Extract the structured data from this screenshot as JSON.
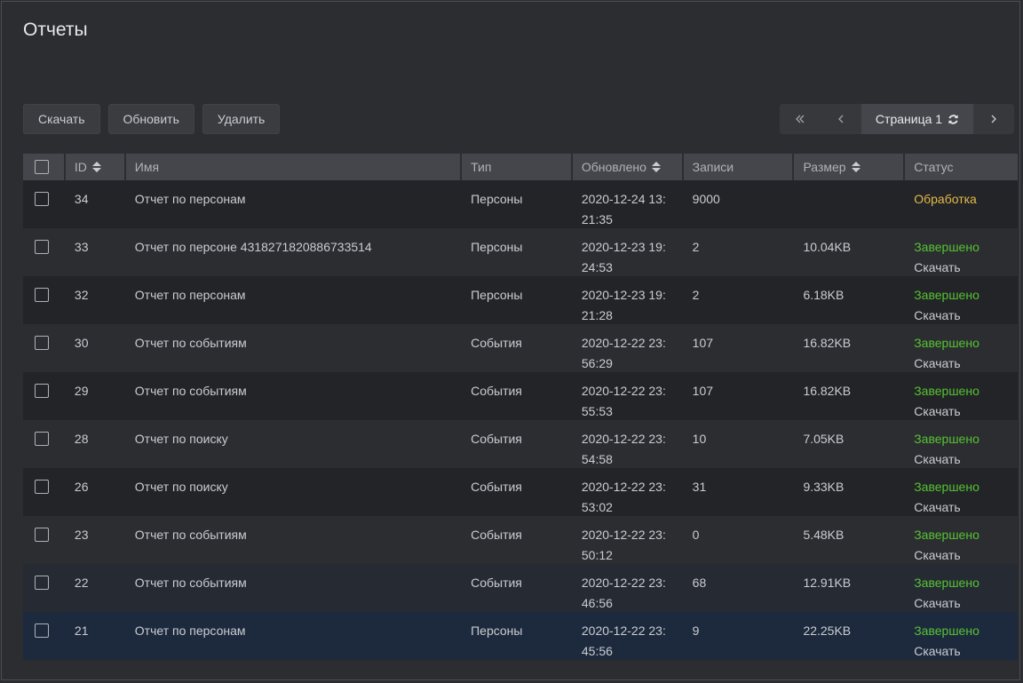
{
  "page": {
    "title": "Отчеты"
  },
  "toolbar": {
    "download": "Скачать",
    "refresh": "Обновить",
    "delete": "Удалить"
  },
  "pager": {
    "current": "Страница 1",
    "first_icon": "double-chevron-left-icon",
    "prev_icon": "chevron-left-icon",
    "next_icon": "chevron-right-icon",
    "refresh_icon": "refresh-icon"
  },
  "columns": {
    "id": "ID",
    "name": "Имя",
    "type": "Тип",
    "updated": "Обновлено",
    "records": "Записи",
    "size": "Размер",
    "status": "Статус"
  },
  "colors": {
    "done": "#56c233",
    "processing": "#e6b84a"
  },
  "rows": [
    {
      "id": "34",
      "name": "Отчет по персонам",
      "type": "Персоны",
      "updated_1": "2020-12-24 13:",
      "updated_2": "21:35",
      "records": "9000",
      "size": "",
      "status": "Обработка",
      "action": ""
    },
    {
      "id": "33",
      "name": "Отчет по персоне 4318271820886733514",
      "type": "Персоны",
      "updated_1": "2020-12-23 19:",
      "updated_2": "24:53",
      "records": "2",
      "size": "10.04KB",
      "status": "Завершено",
      "action": "Скачать"
    },
    {
      "id": "32",
      "name": "Отчет по персонам",
      "type": "Персоны",
      "updated_1": "2020-12-23 19:",
      "updated_2": "21:28",
      "records": "2",
      "size": "6.18KB",
      "status": "Завершено",
      "action": "Скачать"
    },
    {
      "id": "30",
      "name": "Отчет по событиям",
      "type": "События",
      "updated_1": "2020-12-22 23:",
      "updated_2": "56:29",
      "records": "107",
      "size": "16.82KB",
      "status": "Завершено",
      "action": "Скачать"
    },
    {
      "id": "29",
      "name": "Отчет по событиям",
      "type": "События",
      "updated_1": "2020-12-22 23:",
      "updated_2": "55:53",
      "records": "107",
      "size": "16.82KB",
      "status": "Завершено",
      "action": "Скачать"
    },
    {
      "id": "28",
      "name": "Отчет по поиску",
      "type": "События",
      "updated_1": "2020-12-22 23:",
      "updated_2": "54:58",
      "records": "10",
      "size": "7.05KB",
      "status": "Завершено",
      "action": "Скачать"
    },
    {
      "id": "26",
      "name": "Отчет по поиску",
      "type": "События",
      "updated_1": "2020-12-22 23:",
      "updated_2": "53:02",
      "records": "31",
      "size": "9.33KB",
      "status": "Завершено",
      "action": "Скачать"
    },
    {
      "id": "23",
      "name": "Отчет по событиям",
      "type": "События",
      "updated_1": "2020-12-22 23:",
      "updated_2": "50:12",
      "records": "0",
      "size": "5.48KB",
      "status": "Завершено",
      "action": "Скачать"
    },
    {
      "id": "22",
      "name": "Отчет по событиям",
      "type": "События",
      "updated_1": "2020-12-22 23:",
      "updated_2": "46:56",
      "records": "68",
      "size": "12.91KB",
      "status": "Завершено",
      "action": "Скачать"
    },
    {
      "id": "21",
      "name": "Отчет по персонам",
      "type": "Персоны",
      "updated_1": "2020-12-22 23:",
      "updated_2": "45:56",
      "records": "9",
      "size": "22.25KB",
      "status": "Завершено",
      "action": "Скачать"
    }
  ]
}
